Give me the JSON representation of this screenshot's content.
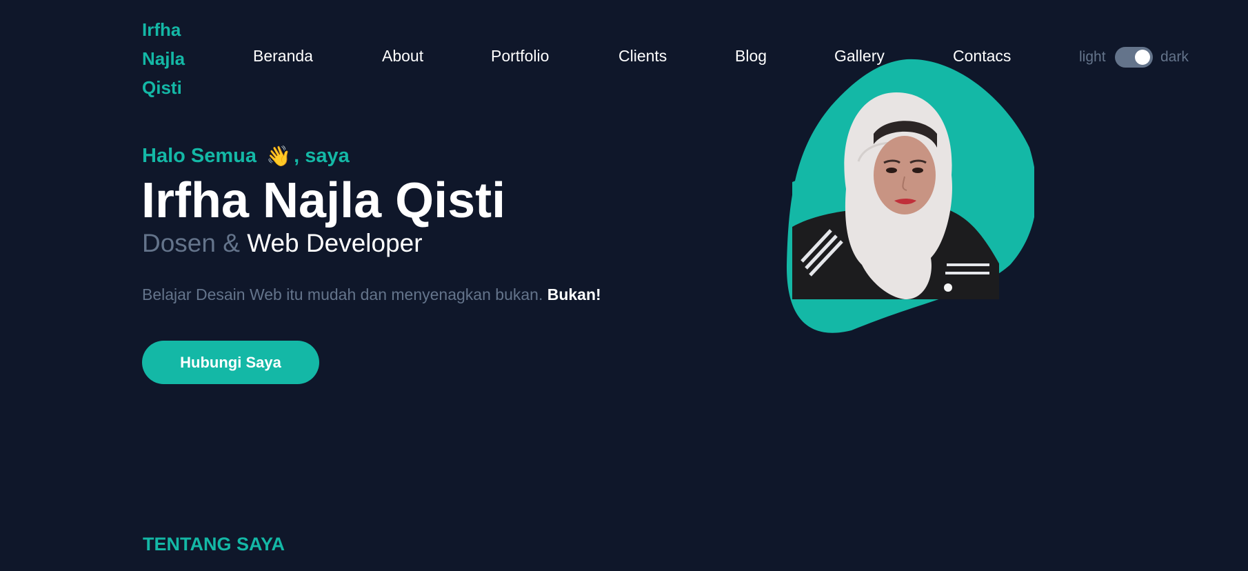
{
  "header": {
    "logo": "Irfha Najla Qisti",
    "nav": [
      "Beranda",
      "About",
      "Portfolio",
      "Clients",
      "Blog",
      "Gallery",
      "Contacs"
    ],
    "theme_toggle": {
      "light_label": "light",
      "dark_label": "dark",
      "state": "dark"
    }
  },
  "hero": {
    "greeting_prefix": "Halo Semua",
    "greeting_emoji": "👋",
    "greeting_suffix": ", saya",
    "name": "Irfha Najla Qisti",
    "role_part1": "Dosen &",
    "role_part2": "Web Developer",
    "tagline": "Belajar Desain Web itu mudah dan menyenagkan bukan.",
    "tagline_strong": "Bukan!",
    "cta_label": "Hubungi Saya"
  },
  "section": {
    "title": "TENTANG SAYA"
  },
  "colors": {
    "background": "#0f172a",
    "accent": "#14b8a6",
    "muted": "#64748b",
    "text": "#ffffff"
  }
}
